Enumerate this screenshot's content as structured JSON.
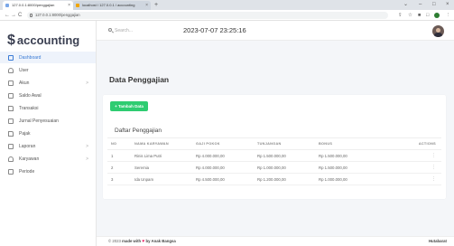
{
  "browser": {
    "tabs": [
      {
        "title": "127.0.0.1:8000/penggajian",
        "close": "×",
        "fav_color": "#7aa7e8"
      },
      {
        "title": "localhost / 127.0.0.1 / accounting",
        "close": "×",
        "fav_color": "#f0a500"
      }
    ],
    "new_tab": "+",
    "url": "127.0.0.1:8000/penggajian",
    "back": "←",
    "forward": "→",
    "reload": "C",
    "window_controls": [
      "⌄",
      "–",
      "□",
      "×"
    ]
  },
  "sidebar": {
    "brand_symbol": "$",
    "brand_name": "accounting",
    "items": [
      {
        "label": "Dashboard",
        "icon": "home-icon",
        "active": true
      },
      {
        "label": "User",
        "icon": "user-icon"
      },
      {
        "label": "Akun",
        "icon": "account-icon",
        "chevron": ">"
      },
      {
        "label": "Saldo Awal",
        "icon": "balance-icon"
      },
      {
        "label": "Transaksi",
        "icon": "transaction-icon"
      },
      {
        "label": "Jurnal Penyesuaian",
        "icon": "journal-icon"
      },
      {
        "label": "Pajak",
        "icon": "tax-icon"
      },
      {
        "label": "Laporan",
        "icon": "report-icon",
        "chevron": ">"
      },
      {
        "label": "Karyawan",
        "icon": "employee-icon",
        "chevron": ">"
      },
      {
        "label": "Periode",
        "icon": "calendar-icon"
      }
    ]
  },
  "topbar": {
    "search_placeholder": "Search...",
    "datetime": "2023-07-07 23:25:16"
  },
  "main": {
    "page_title": "Data Penggajian",
    "add_button": "+ Tambah Data",
    "list_title": "Daftar Penggajian",
    "columns": [
      "NO",
      "NAMA KARYAWAN",
      "GAJI POKOK",
      "TUNJANGAN",
      "BONUS",
      "ACTIONS"
    ],
    "rows": [
      {
        "no": "1",
        "nama": "Rinis Lima Putri",
        "gaji": "Rp 4.000.000,00",
        "tunjangan": "Rp 1.500.000,00",
        "bonus": "Rp 1.500.000,00",
        "action": "⋮"
      },
      {
        "no": "2",
        "nama": "Seremia",
        "gaji": "Rp 4.000.000,00",
        "tunjangan": "Rp 1.000.000,00",
        "bonus": "Rp 1.500.000,00",
        "action": "⋮"
      },
      {
        "no": "3",
        "nama": "Ida Unpam",
        "gaji": "Rp 4.500.000,00",
        "tunjangan": "Rp 1.200.000,00",
        "bonus": "Rp 1.000.000,00",
        "action": "⋮"
      }
    ]
  },
  "footer": {
    "prefix": "© 2023 ",
    "made_with": "made with",
    "heart": "♥",
    "by": " by Anak Bangsa",
    "right": "Hutabarat"
  },
  "colors": {
    "accent": "#3a7bd5",
    "add_button": "#2ecc71",
    "heart": "#e91e63"
  }
}
